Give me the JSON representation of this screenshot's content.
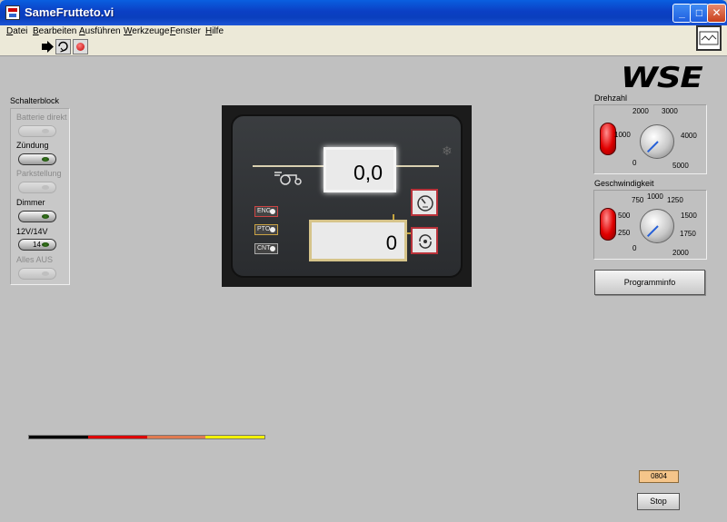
{
  "window": {
    "title": "SameFrutteto.vi",
    "minimize_glyph": "_",
    "maximize_glyph": "□",
    "close_glyph": "✕"
  },
  "menu": {
    "items": [
      "Datei",
      "Bearbeiten",
      "Ausführen",
      "Werkzeuge",
      "Fenster",
      "Hilfe"
    ]
  },
  "toolbar": {
    "icons": [
      "run-arrow-icon",
      "run-continuously-icon",
      "abort-icon"
    ]
  },
  "logo": {
    "text": "WSE"
  },
  "schalterblock": {
    "title": "Schalterblock",
    "switches": [
      {
        "label": "Batterie direkt",
        "enabled": false,
        "on": false,
        "text": ""
      },
      {
        "label": "Zündung",
        "enabled": true,
        "on": true,
        "text": ""
      },
      {
        "label": "Parkstellung",
        "enabled": false,
        "on": false,
        "text": ""
      },
      {
        "label": "Dimmer",
        "enabled": true,
        "on": true,
        "text": ""
      },
      {
        "label": "12V/14V",
        "enabled": true,
        "on": true,
        "text": "14"
      },
      {
        "label": "Alles AUS",
        "enabled": false,
        "on": false,
        "text": ""
      }
    ]
  },
  "dash": {
    "upper_value": "0,0",
    "lower_value": "0",
    "tags": [
      "ENG",
      "PTO",
      "CNT"
    ]
  },
  "drehzahl": {
    "title": "Drehzahl",
    "ticks": [
      "0",
      "1000",
      "2000",
      "3000",
      "4000",
      "5000"
    ],
    "value": 0
  },
  "geschwindigkeit": {
    "title": "Geschwindigkeit",
    "ticks": [
      "0",
      "250",
      "500",
      "750",
      "1000",
      "1250",
      "1500",
      "1750",
      "2000"
    ],
    "value": 0
  },
  "programminfo_button": {
    "label": "Programminfo"
  },
  "colorbar": {
    "colors": [
      "#000000",
      "#dd0000",
      "#e07a50",
      "#f2f000"
    ]
  },
  "status_code": "0804",
  "stop_button": {
    "label": "Stop"
  },
  "colors": {
    "titlebar": "#0b3fc4",
    "panel": "#c0c0c0",
    "led_red": "#e00000",
    "switch_led_green": "#2f6a16",
    "status_box": "#f5c58a"
  }
}
